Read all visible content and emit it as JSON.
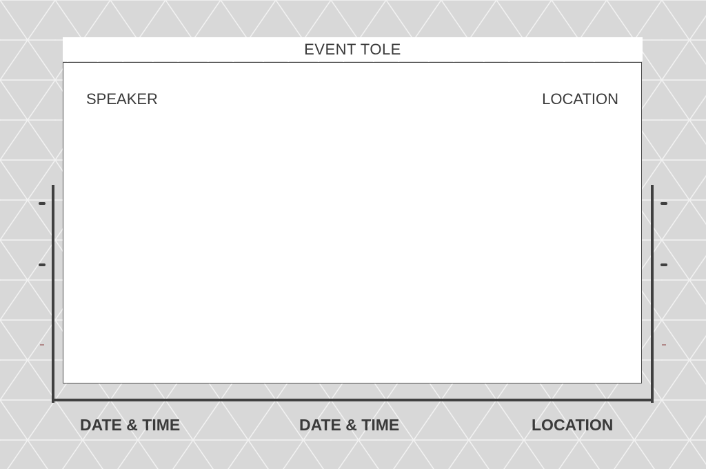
{
  "header": {
    "title": "EVENT TOLE"
  },
  "card": {
    "speaker_label": "SPEAKER",
    "location_label": "LOCATION"
  },
  "footer": {
    "items": [
      "DATE & TIME",
      "DATE & TIME",
      "LOCATION"
    ]
  },
  "colors": {
    "background": "#d8d8d8",
    "pattern_lines": "#f2f2f2",
    "card": "#ffffff",
    "frame": "#404040",
    "text": "#3a3a3a"
  }
}
